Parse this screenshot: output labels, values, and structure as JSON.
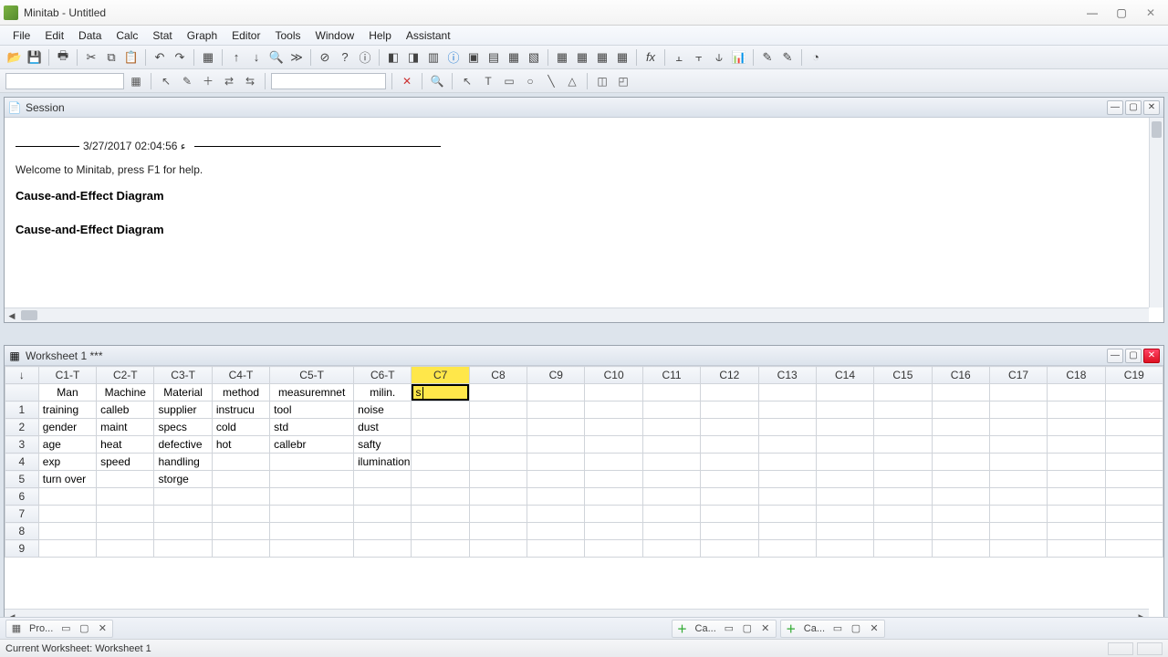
{
  "window": {
    "title": "Minitab - Untitled"
  },
  "menus": [
    "File",
    "Edit",
    "Data",
    "Calc",
    "Stat",
    "Graph",
    "Editor",
    "Tools",
    "Window",
    "Help",
    "Assistant"
  ],
  "session": {
    "title": "Session",
    "timestamp": "3/27/2017 02:04:56 ء",
    "welcome": "Welcome to Minitab, press F1 for help.",
    "heading1": "Cause-and-Effect Diagram",
    "heading2": "Cause-and-Effect Diagram"
  },
  "worksheet": {
    "title": "Worksheet 1 ***",
    "row_marker": "↓",
    "columns": [
      "C1-T",
      "C2-T",
      "C3-T",
      "C4-T",
      "C5-T",
      "C6-T",
      "C7",
      "C8",
      "C9",
      "C10",
      "C11",
      "C12",
      "C13",
      "C14",
      "C15",
      "C16",
      "C17",
      "C18",
      "C19"
    ],
    "names": [
      "Man",
      "Machine",
      "Material",
      "method",
      "measuremnet",
      "milin.",
      "s",
      "",
      "",
      "",
      "",
      "",
      "",
      "",
      "",
      "",
      "",
      "",
      ""
    ],
    "active_edit": "s",
    "rows": [
      [
        "training",
        "calleb",
        "supplier",
        "instrucu",
        "tool",
        "noise",
        "",
        "",
        "",
        "",
        "",
        "",
        "",
        "",
        "",
        "",
        "",
        "",
        ""
      ],
      [
        "gender",
        "maint",
        "specs",
        "cold",
        "std",
        "dust",
        "",
        "",
        "",
        "",
        "",
        "",
        "",
        "",
        "",
        "",
        "",
        "",
        ""
      ],
      [
        "age",
        "heat",
        "defective",
        "hot",
        "callebr",
        "safty",
        "",
        "",
        "",
        "",
        "",
        "",
        "",
        "",
        "",
        "",
        "",
        "",
        ""
      ],
      [
        "exp",
        "speed",
        "handling",
        "",
        "",
        "ilumination",
        "",
        "",
        "",
        "",
        "",
        "",
        "",
        "",
        "",
        "",
        "",
        "",
        ""
      ],
      [
        "turn over",
        "",
        "storge",
        "",
        "",
        "",
        "",
        "",
        "",
        "",
        "",
        "",
        "",
        "",
        "",
        "",
        "",
        "",
        ""
      ],
      [
        "",
        "",
        "",
        "",
        "",
        "",
        "",
        "",
        "",
        "",
        "",
        "",
        "",
        "",
        "",
        "",
        "",
        "",
        ""
      ],
      [
        "",
        "",
        "",
        "",
        "",
        "",
        "",
        "",
        "",
        "",
        "",
        "",
        "",
        "",
        "",
        "",
        "",
        "",
        ""
      ],
      [
        "",
        "",
        "",
        "",
        "",
        "",
        "",
        "",
        "",
        "",
        "",
        "",
        "",
        "",
        "",
        "",
        "",
        "",
        ""
      ],
      [
        "",
        "",
        "",
        "",
        "",
        "",
        "",
        "",
        "",
        "",
        "",
        "",
        "",
        "",
        "",
        "",
        "",
        "",
        ""
      ]
    ],
    "sel_col_index": 6
  },
  "bottombar": {
    "pro_label": "Pro...",
    "ca_label": "Ca..."
  },
  "status": {
    "text": "Current Worksheet: Worksheet 1"
  }
}
